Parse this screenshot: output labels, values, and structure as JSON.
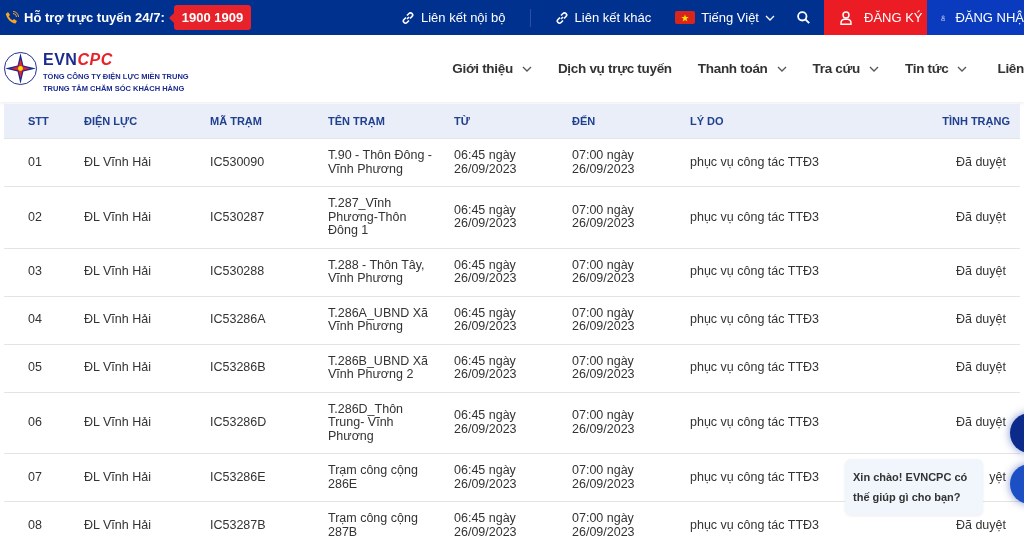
{
  "top_bar": {
    "support_label": "Hỗ trợ trực tuyến 24/7:",
    "hotline": "1900 1909",
    "links": [
      {
        "label": "Liên kết nội bộ"
      },
      {
        "label": "Liên kết khác"
      }
    ],
    "language": "Tiếng Việt",
    "register": "ĐĂNG KÝ",
    "login": "ĐĂNG NHẬ"
  },
  "header": {
    "brand_first": "EVN",
    "brand_second": "CPC",
    "subtitle_lines": [
      "TỔNG CÔNG TY ĐIỆN LỰC MIỀN TRUNG",
      "TRUNG TÂM CHĂM SÓC KHÁCH HÀNG"
    ],
    "nav": [
      {
        "label": "Giới thiệu",
        "has_dropdown": true
      },
      {
        "label": "Dịch vụ trực tuyến",
        "has_dropdown": false
      },
      {
        "label": "Thanh toán",
        "has_dropdown": true
      },
      {
        "label": "Tra cứu",
        "has_dropdown": true
      },
      {
        "label": "Tin tức",
        "has_dropdown": true
      },
      {
        "label": "Liên",
        "has_dropdown": false
      }
    ]
  },
  "table": {
    "columns": [
      "STT",
      "ĐIỆN LỰC",
      "MÃ TRẠM",
      "TÊN TRẠM",
      "TỪ",
      "ĐẾN",
      "LÝ DO",
      "TÌNH TRẠNG"
    ],
    "rows": [
      [
        "01",
        "ĐL Vĩnh Hải",
        "IC530090",
        "T.90 - Thôn Đông - Vĩnh Phương",
        "06:45 ngày 26/09/2023",
        "07:00 ngày 26/09/2023",
        "phục vụ công tác TTĐ3",
        "Đã duyệt"
      ],
      [
        "02",
        "ĐL Vĩnh Hải",
        "IC530287",
        "T.287_Vĩnh Phương-Thôn Đông 1",
        "06:45 ngày 26/09/2023",
        "07:00 ngày 26/09/2023",
        "phục vụ công tác TTĐ3",
        "Đã duyệt"
      ],
      [
        "03",
        "ĐL Vĩnh Hải",
        "IC530288",
        "T.288 - Thôn Tây, Vĩnh Phương",
        "06:45 ngày 26/09/2023",
        "07:00 ngày 26/09/2023",
        "phục vụ công tác TTĐ3",
        "Đã duyệt"
      ],
      [
        "04",
        "ĐL Vĩnh Hải",
        "IC53286A",
        "T.286A_UBND Xã Vĩnh Phương",
        "06:45 ngày 26/09/2023",
        "07:00 ngày 26/09/2023",
        "phục vụ công tác TTĐ3",
        "Đã duyệt"
      ],
      [
        "05",
        "ĐL Vĩnh Hải",
        "IC53286B",
        "T.286B_UBND Xã Vĩnh Phương 2",
        "06:45 ngày 26/09/2023",
        "07:00 ngày 26/09/2023",
        "phục vụ công tác TTĐ3",
        "Đã duyệt"
      ],
      [
        "06",
        "ĐL Vĩnh Hải",
        "IC53286D",
        "T.286D_Thôn Trung- Vĩnh Phương",
        "06:45 ngày 26/09/2023",
        "07:00 ngày 26/09/2023",
        "phục vụ công tác TTĐ3",
        "Đã duyệt"
      ],
      [
        "07",
        "ĐL Vĩnh Hải",
        "IC53286E",
        "Trạm công cộng 286E",
        "06:45 ngày 26/09/2023",
        "07:00 ngày 26/09/2023",
        "phục vụ công tác TTĐ3",
        "yệt"
      ],
      [
        "08",
        "ĐL Vĩnh Hải",
        "IC53287B",
        "Trạm công cộng 287B",
        "06:45 ngày 26/09/2023",
        "07:00 ngày 26/09/2023",
        "phục vụ công tác TTĐ3",
        "Đã duyệt"
      ]
    ]
  },
  "chat": {
    "message": "Xin chào! EVNCPC có thế giúp gì cho bạn?"
  }
}
